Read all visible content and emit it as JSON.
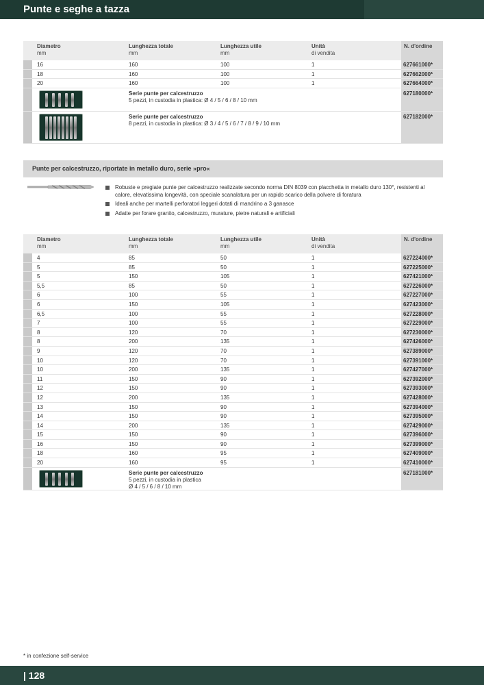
{
  "header": {
    "title": "Punte e seghe a tazza"
  },
  "columns": {
    "diametro": "Diametro",
    "diametro_unit": "mm",
    "lunghezza_totale": "Lunghezza totale",
    "lunghezza_totale_unit": "mm",
    "lunghezza_utile": "Lunghezza utile",
    "lunghezza_utile_unit": "mm",
    "unita": "Unità",
    "unita_sub": "di vendita",
    "ordine": "N. d'ordine"
  },
  "table1": {
    "rows": [
      {
        "d": "16",
        "lt": "160",
        "lu": "100",
        "u": "1",
        "n": "627661000*"
      },
      {
        "d": "18",
        "lt": "160",
        "lu": "100",
        "u": "1",
        "n": "627662000*"
      },
      {
        "d": "20",
        "lt": "160",
        "lu": "100",
        "u": "1",
        "n": "627664000*"
      }
    ],
    "sets": [
      {
        "title": "Serie punte per calcestruzzo",
        "line1": "5 pezzi, in custodia in plastica: Ø 4 / 5 / 6 / 8 / 10 mm",
        "line2": "",
        "n": "627180000*"
      },
      {
        "title": "Serie punte per calcestruzzo",
        "line1": "8 pezzi, in custodia in plastica: Ø 3 / 4 / 5 / 6 / 7 / 8 / 9 / 10 mm",
        "line2": "",
        "n": "627182000*"
      }
    ]
  },
  "section": {
    "title": "Punte per calcestruzzo, riportate in metallo duro, serie »pro«",
    "bullets": [
      "Robuste e pregiate punte per calcestruzzo realizzate secondo norma DIN 8039 con placchetta in metallo duro 130°, resistenti al calore, elevatissima longevità, con speciale scanalatura per un rapido scarico della polvere di foratura",
      "Ideali anche per martelli perforatori leggeri dotati di mandrino a 3 ganasce",
      "Adatte per forare granito, calcestruzzo, murature, pietre naturali e artificiali"
    ]
  },
  "table2": {
    "rows": [
      {
        "d": "4",
        "lt": "85",
        "lu": "50",
        "u": "1",
        "n": "627224000*"
      },
      {
        "d": "5",
        "lt": "85",
        "lu": "50",
        "u": "1",
        "n": "627225000*"
      },
      {
        "d": "5",
        "lt": "150",
        "lu": "105",
        "u": "1",
        "n": "627421000*"
      },
      {
        "d": "5,5",
        "lt": "85",
        "lu": "50",
        "u": "1",
        "n": "627226000*"
      },
      {
        "d": "6",
        "lt": "100",
        "lu": "55",
        "u": "1",
        "n": "627227000*"
      },
      {
        "d": "6",
        "lt": "150",
        "lu": "105",
        "u": "1",
        "n": "627423000*"
      },
      {
        "d": "6,5",
        "lt": "100",
        "lu": "55",
        "u": "1",
        "n": "627228000*"
      },
      {
        "d": "7",
        "lt": "100",
        "lu": "55",
        "u": "1",
        "n": "627229000*"
      },
      {
        "d": "8",
        "lt": "120",
        "lu": "70",
        "u": "1",
        "n": "627230000*"
      },
      {
        "d": "8",
        "lt": "200",
        "lu": "135",
        "u": "1",
        "n": "627426000*"
      },
      {
        "d": "9",
        "lt": "120",
        "lu": "70",
        "u": "1",
        "n": "627389000*"
      },
      {
        "d": "10",
        "lt": "120",
        "lu": "70",
        "u": "1",
        "n": "627391000*"
      },
      {
        "d": "10",
        "lt": "200",
        "lu": "135",
        "u": "1",
        "n": "627427000*"
      },
      {
        "d": "11",
        "lt": "150",
        "lu": "90",
        "u": "1",
        "n": "627392000*"
      },
      {
        "d": "12",
        "lt": "150",
        "lu": "90",
        "u": "1",
        "n": "627393000*"
      },
      {
        "d": "12",
        "lt": "200",
        "lu": "135",
        "u": "1",
        "n": "627428000*"
      },
      {
        "d": "13",
        "lt": "150",
        "lu": "90",
        "u": "1",
        "n": "627394000*"
      },
      {
        "d": "14",
        "lt": "150",
        "lu": "90",
        "u": "1",
        "n": "627395000*"
      },
      {
        "d": "14",
        "lt": "200",
        "lu": "135",
        "u": "1",
        "n": "627429000*"
      },
      {
        "d": "15",
        "lt": "150",
        "lu": "90",
        "u": "1",
        "n": "627396000*"
      },
      {
        "d": "16",
        "lt": "150",
        "lu": "90",
        "u": "1",
        "n": "627399000*"
      },
      {
        "d": "18",
        "lt": "160",
        "lu": "95",
        "u": "1",
        "n": "627409000*"
      },
      {
        "d": "20",
        "lt": "160",
        "lu": "95",
        "u": "1",
        "n": "627410000*"
      }
    ],
    "sets": [
      {
        "title": "Serie punte per calcestruzzo",
        "line1": "5 pezzi, in custodia in plastica",
        "line2": "Ø 4 / 5 / 6 / 8 / 10 mm",
        "n": "627181000*"
      }
    ]
  },
  "footnote": "* in confezione self-service",
  "footer": {
    "page": "| 128"
  },
  "colors": {
    "header_green": "#1e3a33",
    "order_column": "#d7d7d7",
    "table_header": "#ececec"
  }
}
